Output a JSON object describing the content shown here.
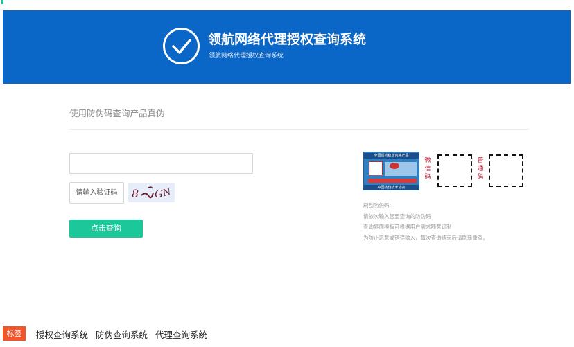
{
  "banner": {
    "title": "领航网络代理授权查询系统",
    "subtitle": "领航网络代理授权查询系统"
  },
  "form": {
    "section_title": "使用防伪码查询产品真伪",
    "code_input": {
      "value": "",
      "placeholder": ""
    },
    "captcha_input": {
      "value": "",
      "placeholder": "请输入验证码"
    },
    "captcha_image": {
      "text": "8 ⌐GN"
    },
    "query_button": "点击查询"
  },
  "sample": {
    "label_card_title": "全国质检稳定合格产品",
    "label_card_footer": "中国防伪技术协会",
    "weixin_label": "微信码",
    "putong_label": "普通码"
  },
  "instructions": {
    "heading": "刷刮防伪码:",
    "lines": [
      "请依次输入您要查询的防伪码",
      "查询界面模板可根据用户需求随意订制",
      "为防止恶意或错误输入，每次查询结束后请刷新重查。"
    ]
  },
  "tags": {
    "badge": "标签",
    "links": [
      "授权查询系统",
      "防伪查询系统",
      "代理查询系统"
    ]
  },
  "colors": {
    "banner": "#0a67c8",
    "button": "#1cc79a",
    "tag_badge": "#f0552b",
    "accent_red": "#c2203a"
  }
}
